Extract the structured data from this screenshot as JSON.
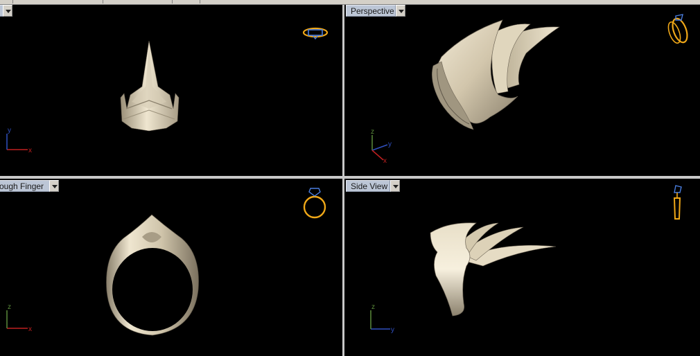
{
  "viewports": {
    "top": {
      "title": ""
    },
    "perspective": {
      "title": "Perspective"
    },
    "through_finger": {
      "title": "ough Finger"
    },
    "side": {
      "title": "Side View"
    }
  },
  "axes": {
    "top": {
      "h": "x",
      "v": "y"
    },
    "perspective": {
      "a": "x",
      "b": "y",
      "c": "z"
    },
    "through_finger": {
      "h": "x",
      "v": "z"
    },
    "side": {
      "h": "y",
      "v": "z"
    }
  },
  "colors": {
    "viewport_bg": "#000000",
    "ring_metal": "#d8cdb5",
    "widget_gold": "#f0a818",
    "widget_blue": "#4a7ee0",
    "axis_red": "#c02020",
    "axis_green": "#5a8a3a",
    "axis_blue": "#3050c0"
  },
  "icons": [
    "ring-orientation-top-icon",
    "ring-orientation-perspective-icon",
    "ring-orientation-front-icon",
    "ring-orientation-side-icon",
    "viewport-menu-arrow-icon"
  ]
}
